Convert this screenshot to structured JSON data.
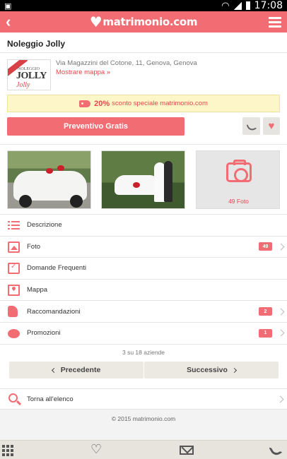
{
  "status_bar": {
    "time": "17:08"
  },
  "app_bar": {
    "logo_text": "matrimonio.com"
  },
  "vendor": {
    "name": "Noleggio Jolly",
    "logo_small": "NOLEGGIO",
    "logo_big": "JOLLY",
    "logo_red": "Jolly",
    "address": "Via Magazzini del Cotone, 11, Genova, Genova",
    "map_link": "Mostrare mappa »"
  },
  "discount": {
    "percent": "20%",
    "text": "sconto speciale matrimonio.com"
  },
  "actions": {
    "quote_label": "Preventivo Gratis"
  },
  "photos": {
    "count_label": "49 Foto"
  },
  "menu": [
    {
      "label": "Descrizione",
      "badge": null
    },
    {
      "label": "Foto",
      "badge": "49"
    },
    {
      "label": "Domande Frequenti",
      "badge": null
    },
    {
      "label": "Mappa",
      "badge": null
    },
    {
      "label": "Raccomandazioni",
      "badge": "2"
    },
    {
      "label": "Promozioni",
      "badge": "1"
    }
  ],
  "pager": {
    "text": "3 su 18 aziende",
    "prev_label": "Precedente",
    "next_label": "Successivo"
  },
  "back_link": {
    "label": "Torna all'elenco"
  },
  "footer": {
    "copyright": "© 2015 matrimonio.com"
  },
  "colors": {
    "brand": "#f16d73",
    "discount_bg": "#fdf6c8",
    "button_gray": "#ece8e2"
  }
}
